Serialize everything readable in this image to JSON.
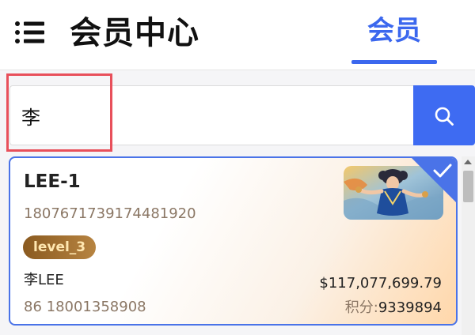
{
  "header": {
    "menu_icon": "list-menu-icon",
    "title": "会员中心",
    "tab_label": "会员"
  },
  "search": {
    "value": "李",
    "icon": "search-icon"
  },
  "member": {
    "name": "LEE-1",
    "id": "1807671739174481920",
    "level": "level_3",
    "real_name": "李LEE",
    "phone": "86 18001358908",
    "balance": "$117,077,699.79",
    "points_label": "积分:",
    "points_value": "9339894",
    "selected": true,
    "selected_icon": "check-icon",
    "avatar_icon": "avatar-image"
  },
  "colors": {
    "accent": "#3b67ee",
    "highlight_border": "#e8505b",
    "muted_text": "#8b7765",
    "badge_gold": "#b78441"
  }
}
